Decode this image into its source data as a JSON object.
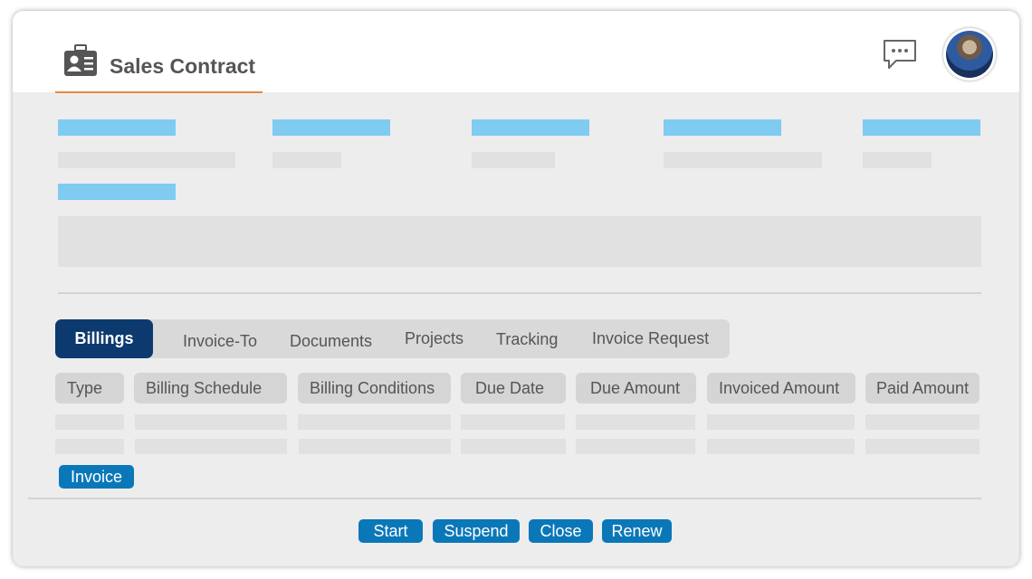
{
  "header": {
    "title": "Sales Contract",
    "icons": {
      "title": "contact-card-icon",
      "chat": "chat-bubble-icon",
      "avatar": "user-avatar"
    },
    "accent_color": "#e8893a"
  },
  "tabs": [
    {
      "label": "Billings",
      "active": true
    },
    {
      "label": "Invoice-To",
      "active": false
    },
    {
      "label": "Documents",
      "active": false
    },
    {
      "label": "Projects",
      "active": false
    },
    {
      "label": "Tracking",
      "active": false
    },
    {
      "label": "Invoice Request",
      "active": false
    }
  ],
  "table": {
    "columns": [
      "Type",
      "Billing Schedule",
      "Billing Conditions",
      "Due Date",
      "Due Amount",
      "Invoiced Amount",
      "Paid Amount"
    ]
  },
  "invoice_button": "Invoice",
  "actions": [
    "Start",
    "Suspend",
    "Close",
    "Renew"
  ],
  "colors": {
    "active_tab": "#0d3a6e",
    "button": "#0a78b8",
    "placeholder_label": "#7fcbf2",
    "placeholder_value": "#e1e1e1"
  }
}
